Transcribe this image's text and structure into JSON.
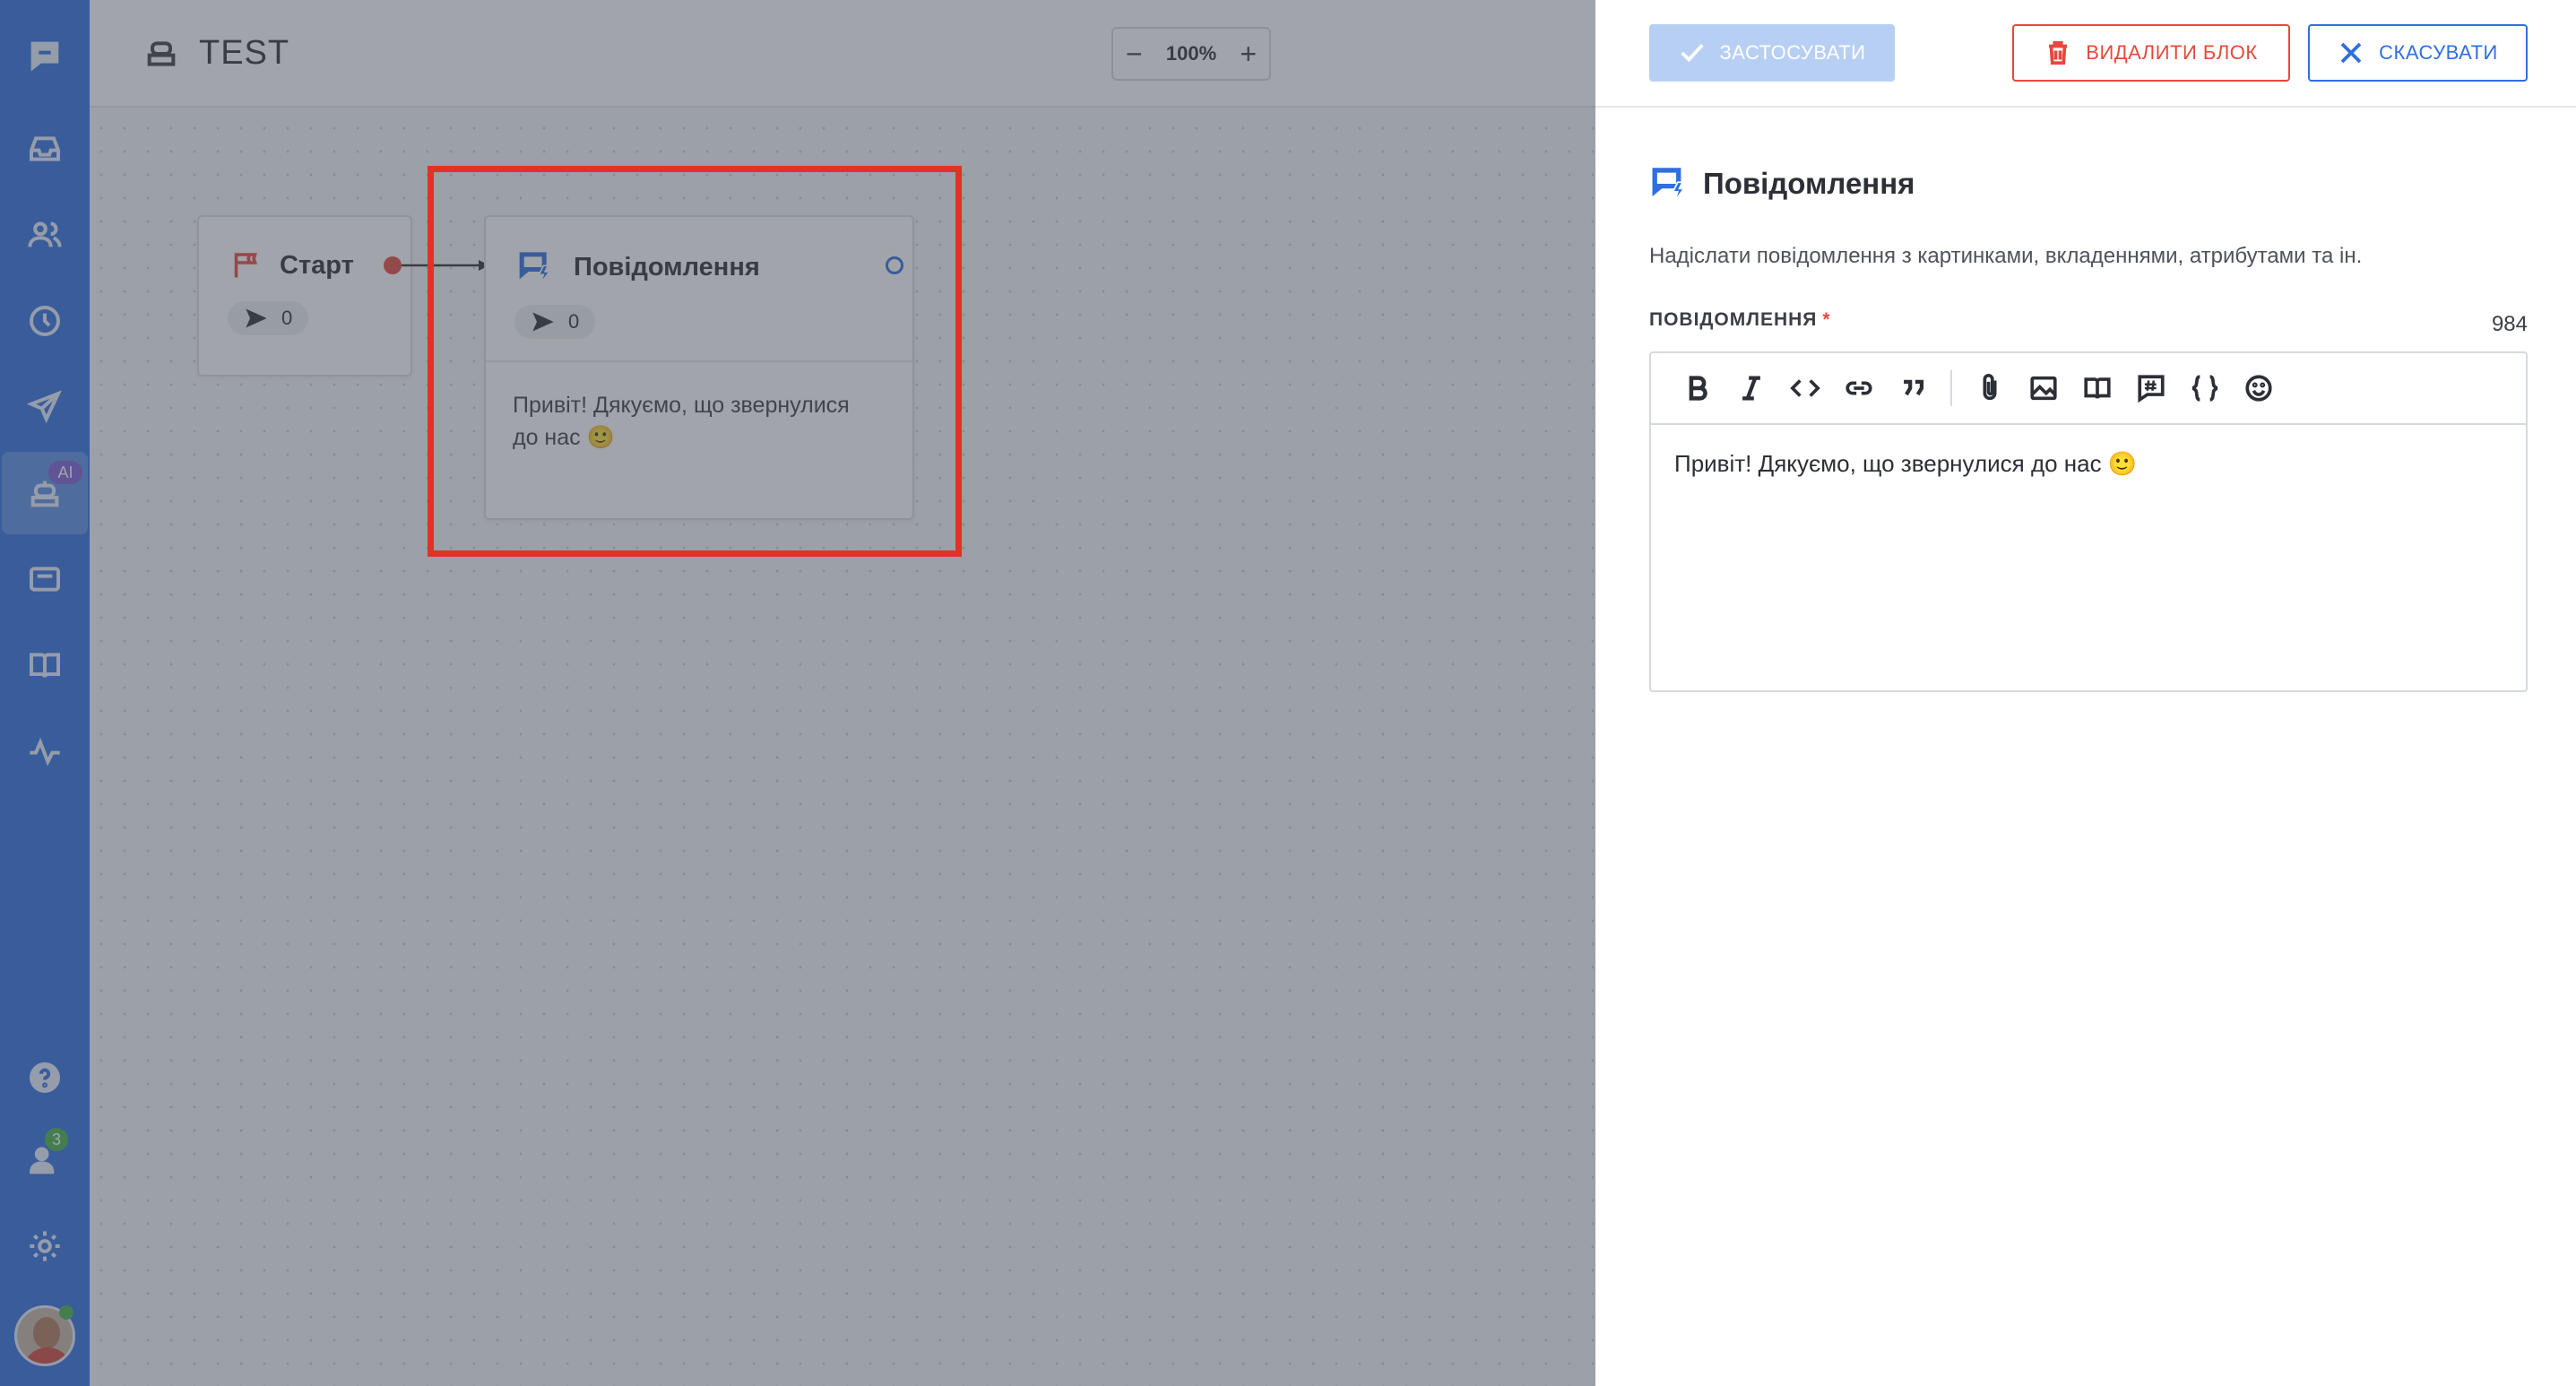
{
  "sidebar": {
    "items": [
      {
        "icon": "chat-logo-icon"
      },
      {
        "icon": "inbox-icon"
      },
      {
        "icon": "contacts-icon"
      },
      {
        "icon": "history-icon"
      },
      {
        "icon": "campaigns-icon"
      },
      {
        "icon": "bot-icon",
        "badge": "AI",
        "active": true
      },
      {
        "icon": "wallet-icon"
      },
      {
        "icon": "knowledge-base-icon"
      },
      {
        "icon": "reports-icon"
      }
    ],
    "bottom": [
      {
        "icon": "help-icon"
      },
      {
        "icon": "team-icon",
        "badge": "3"
      },
      {
        "icon": "settings-icon"
      }
    ],
    "accent": "#2f6fe0"
  },
  "canvas": {
    "bot_name": "TEST",
    "zoom_level": "100%",
    "zoom_out": "−",
    "zoom_in": "+",
    "nodes": {
      "start": {
        "title": "Старт",
        "count": "0"
      },
      "message": {
        "title": "Повідомлення",
        "count": "0",
        "text": "Привіт! Дякуємо, що звернулися до нас 🙂"
      }
    }
  },
  "panel": {
    "apply_label": "ЗАСТОСУВАТИ",
    "delete_label": "ВИДАЛИТИ БЛОК",
    "cancel_label": "СКАСУВАТИ",
    "title": "Повідомлення",
    "description": "Надіслати повідомлення з картинками, вкладеннями, атрибутами та ін.",
    "field_label": "ПОВІДОМЛЕННЯ",
    "required_mark": "*",
    "char_count": "984",
    "message_text": "Привіт! Дякуємо, що звернулися до нас 🙂",
    "toolbar": [
      "bold-icon",
      "italic-icon",
      "code-icon",
      "link-icon",
      "quote-icon",
      "attachment-icon",
      "image-icon",
      "article-icon",
      "hashtag-icon",
      "variable-icon",
      "emoji-icon"
    ]
  },
  "colors": {
    "danger": "#e5493e",
    "primary": "#2f6fe0",
    "apply_disabled": "#b8cff4",
    "highlight": "#e33128"
  }
}
